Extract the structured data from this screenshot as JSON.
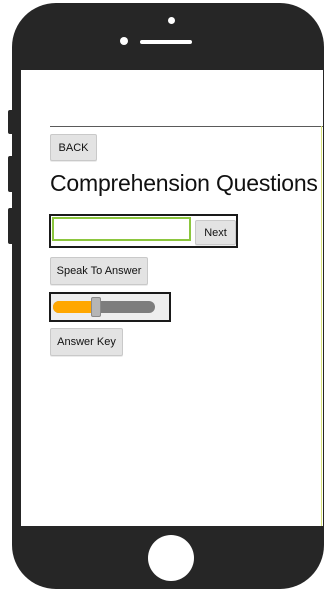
{
  "app": {
    "back_label": "BACK",
    "title": "Comprehension Questions",
    "answer_input": {
      "value": "",
      "placeholder": ""
    },
    "next_label": "Next",
    "speak_label": "Speak To Answer",
    "volume_slider": {
      "value_fraction": 0.42
    },
    "answer_key_label": "Answer Key"
  },
  "colors": {
    "phone_body": "#262626",
    "input_border_focus": "#8cc63e",
    "slider_fill": "#ffa700",
    "slider_track": "#7d7d7d"
  },
  "icons": {
    "camera": "camera-icon",
    "speaker": "speaker-icon",
    "home_button": "home-button-icon"
  }
}
